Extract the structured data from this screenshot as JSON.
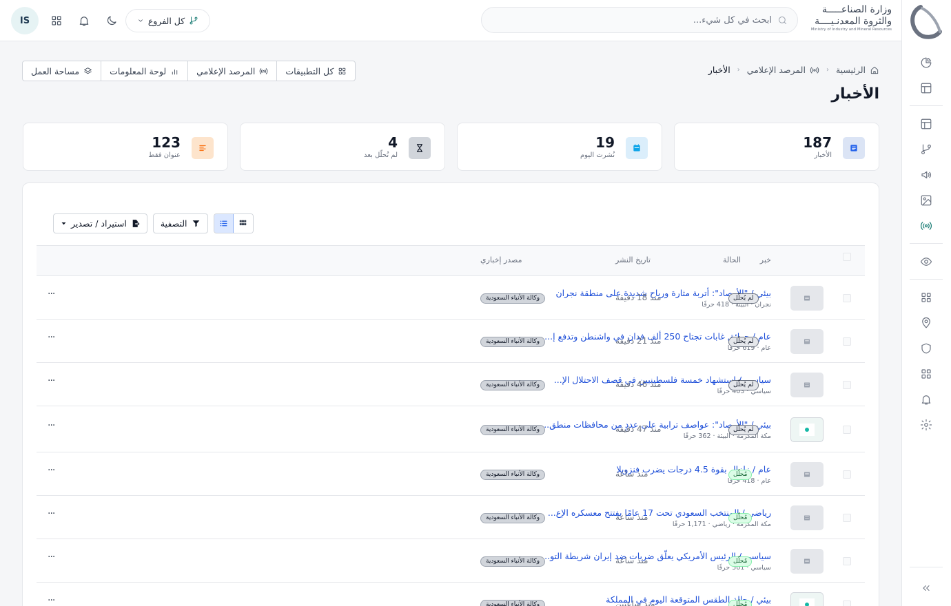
{
  "header": {
    "ministry_line1": "وزارة الصناعـــــة",
    "ministry_line2": "والثروة المعدنـيــــة",
    "ministry_en": "Ministry of Industry and Mineral Resources",
    "search_placeholder": "ابحث في كل شيء...",
    "branch_label": "كل الفروع",
    "avatar_initials": "IS"
  },
  "breadcrumb": {
    "home": "الرئيسية",
    "media": "المرصد الإعلامي",
    "current": "الأخبار"
  },
  "page_title": "الأخبار",
  "app_tabs": [
    {
      "label": "كل التطبيقات",
      "icon": "grid-icon"
    },
    {
      "label": "المرصد الإعلامي",
      "icon": "broadcast-icon"
    },
    {
      "label": "لوحة المعلومات",
      "icon": "bar-chart-icon"
    },
    {
      "label": "مساحة العمل",
      "icon": "layers-icon"
    }
  ],
  "stats": [
    {
      "value": "187",
      "label": "الأخبار",
      "icon": "newspaper-icon",
      "color": "#2563eb",
      "bg": "#dbe4f5"
    },
    {
      "value": "19",
      "label": "نُشرت اليوم",
      "icon": "calendar-icon",
      "color": "#0ea5e9",
      "bg": "#dbeefb"
    },
    {
      "value": "4",
      "label": "لم تُحلّل بعد",
      "icon": "hourglass-icon",
      "color": "#111827",
      "bg": "#d1d5db"
    },
    {
      "value": "123",
      "label": "عنوان فقط",
      "icon": "align-icon",
      "color": "#f97316",
      "bg": "#fde4cc"
    }
  ],
  "toolbar": {
    "import_export": "استيراد / تصدير",
    "filter": "التصفية"
  },
  "table": {
    "headers": {
      "news": "خبر",
      "source": "مصدر إخباري",
      "date": "تاريخ النشر",
      "status": "الحالة"
    },
    "rows": [
      {
        "title": "بيئي / \"الأرصاد\": أتربة مثارة ورياح شديدة على منطقة نجران",
        "meta": "نجران · البيئة · 418 حرفًا",
        "source": "وكالة الأنباء السعودية",
        "time": "منذ 18 دقيقة",
        "status": "لم يُحلّل",
        "status_type": "pending",
        "thumb": "placeholder"
      },
      {
        "title": "عام / حرائق غابات تجتاح 250 ألف فدان في واشنطن وتدفع إ...",
        "meta": "عام · 619 حرفًا",
        "source": "وكالة الأنباء السعودية",
        "time": "منذ 21 دقيقة",
        "status": "لم يُحلّل",
        "status_type": "pending",
        "thumb": "placeholder"
      },
      {
        "title": "سياسي / استشهاد خمسة فلسطينيين في قصف الاحتلال الإ...",
        "meta": "سياسي · 403 حرفًا",
        "source": "وكالة الأنباء السعودية",
        "time": "منذ 46 دقيقة",
        "status": "لم يُحلّل",
        "status_type": "pending",
        "thumb": "placeholder"
      },
      {
        "title": "بيئي / \"الأرصاد\": عواصف ترابية على عددٍ من محافظات منطق...",
        "meta": "مكة المكرمة · البيئة · 362 حرفًا",
        "source": "وكالة الأنباء السعودية",
        "time": "منذ 47 دقيقة",
        "status": "لم يُحلّل",
        "status_type": "pending",
        "thumb": "image"
      },
      {
        "title": "عام / زلزال بقوة 4.5 درجات يضرب فنزويلا",
        "meta": "عام · 418 حرفًا",
        "source": "وكالة الأنباء السعودية",
        "time": "منذ ساعة",
        "status": "مُحلّل",
        "status_type": "done",
        "thumb": "placeholder"
      },
      {
        "title": "رياضي / المنتخب السعودي تحت 17 عامًا يفتتح معسكره الإع...",
        "meta": "مكة المكرمة · رياضي · 1,171 حرفًا",
        "source": "وكالة الأنباء السعودية",
        "time": "منذ ساعة",
        "status": "مُحلّل",
        "status_type": "done",
        "thumb": "placeholder"
      },
      {
        "title": "سياسي / الرئيس الأمريكي يعلّق ضربات ضد إيران شريطة التو...",
        "meta": "سياسي · 501 حرفًا",
        "source": "وكالة الأنباء السعودية",
        "time": "منذ ساعة",
        "status": "مُحلّل",
        "status_type": "done",
        "thumb": "placeholder"
      },
      {
        "title": "بيئي / حالة الطقس المتوقعة اليوم في المملكة",
        "meta": "",
        "source": "وكالة الأنباء السعودية",
        "time": "منذ ساعتين",
        "status": "مُحلّل",
        "status_type": "done",
        "thumb": "image"
      }
    ]
  }
}
